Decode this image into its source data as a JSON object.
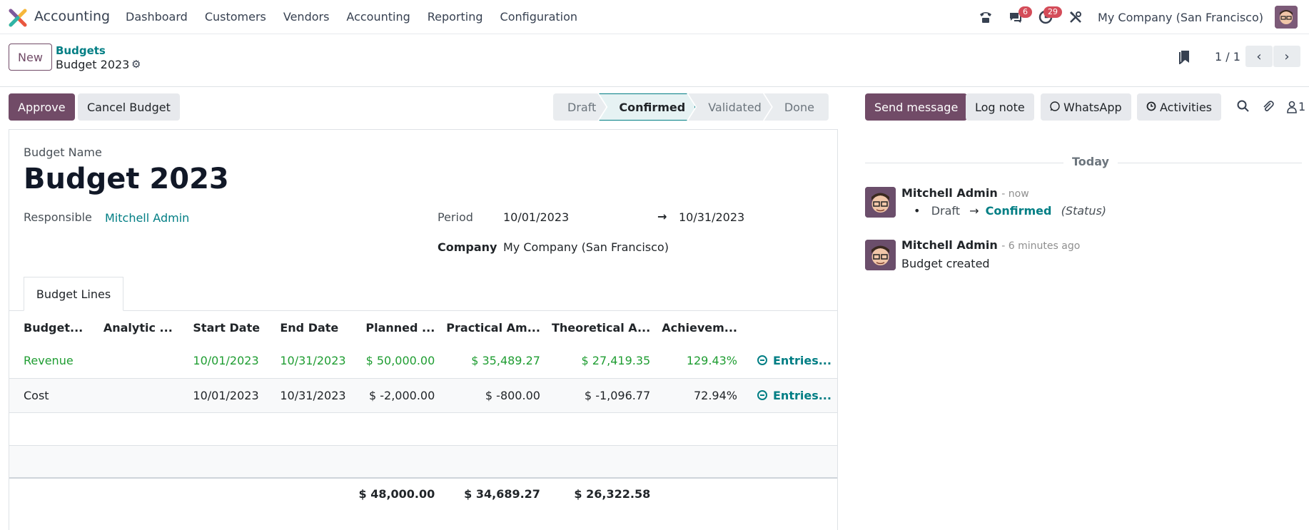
{
  "navbar": {
    "app_name": "Accounting",
    "menu": [
      "Dashboard",
      "Customers",
      "Vendors",
      "Accounting",
      "Reporting",
      "Configuration"
    ],
    "messages_count": "6",
    "activities_count": "29",
    "company": "My Company (San Francisco)"
  },
  "control": {
    "new_label": "New",
    "breadcrumb_parent": "Budgets",
    "breadcrumb_current": "Budget 2023",
    "pager": "1 / 1"
  },
  "statusbar": {
    "approve_label": "Approve",
    "cancel_label": "Cancel Budget",
    "stages": [
      "Draft",
      "Confirmed",
      "Validated",
      "Done"
    ],
    "active_stage": "Confirmed"
  },
  "form": {
    "budget_name_label": "Budget Name",
    "budget_name": "Budget 2023",
    "responsible_label": "Responsible",
    "responsible": "Mitchell Admin",
    "period_label": "Period",
    "period_start": "10/01/2023",
    "period_arrow": "→",
    "period_end": "10/31/2023",
    "company_label": "Company",
    "company": "My Company (San Francisco)",
    "tab_label": "Budget Lines"
  },
  "table": {
    "headers": [
      "Budget...",
      "Analytic ...",
      "Start Date",
      "End Date",
      "Planned ...",
      "Practical Am...",
      "Theoretical A...",
      "Achievem..."
    ],
    "rows": [
      {
        "budget": "Revenue",
        "analytic": "",
        "start": "10/01/2023",
        "end": "10/31/2023",
        "planned": "$ 50,000.00",
        "practical": "$ 35,489.27",
        "theoretical": "$ 27,419.35",
        "achievement": "129.43%",
        "entries": "Entries..."
      },
      {
        "budget": "Cost",
        "analytic": "",
        "start": "10/01/2023",
        "end": "10/31/2023",
        "planned": "$ -2,000.00",
        "practical": "$ -800.00",
        "theoretical": "$ -1,096.77",
        "achievement": "72.94%",
        "entries": "Entries..."
      }
    ],
    "totals": {
      "planned": "$ 48,000.00",
      "practical": "$ 34,689.27",
      "theoretical": "$ 26,322.58"
    }
  },
  "chatter": {
    "send_message": "Send message",
    "log_note": "Log note",
    "whatsapp": "WhatsApp",
    "activities": "Activities",
    "followers_count": "1",
    "today_label": "Today",
    "messages": [
      {
        "author": "Mitchell Admin",
        "time": "- now",
        "from_status": "Draft",
        "arrow": "→",
        "to_status": "Confirmed",
        "field": "(Status)"
      },
      {
        "author": "Mitchell Admin",
        "time": "- 6 minutes ago",
        "body": "Budget created"
      }
    ]
  },
  "colors": {
    "primary": "#714b67",
    "link": "#017e84",
    "success": "#1f9d32",
    "badge": "#d44c59"
  }
}
